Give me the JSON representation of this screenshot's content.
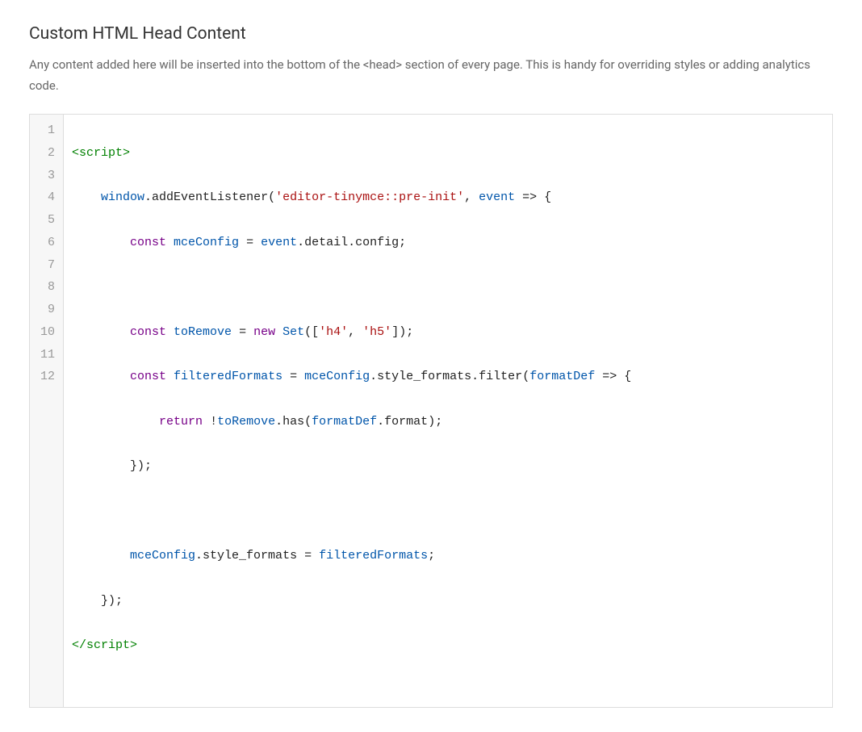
{
  "heading": "Custom HTML Head Content",
  "description": "Any content added here will be inserted into the bottom of the <head> section of every page. This is handy for overriding styles or adding analytics code.",
  "line_numbers": [
    "1",
    "2",
    "3",
    "4",
    "5",
    "6",
    "7",
    "8",
    "9",
    "10",
    "11",
    "12"
  ],
  "code": {
    "l1": {
      "open_tag_lt": "<",
      "open_tag_name": "script",
      "open_tag_gt": ">"
    },
    "l2": {
      "indent": "    ",
      "obj": "window",
      "dot1": ".",
      "method": "addEventListener",
      "paren_open": "(",
      "str": "'editor-tinymce::pre-init'",
      "comma": ", ",
      "param": "event",
      "arrow": " => {"
    },
    "l3": {
      "indent": "        ",
      "kw": "const",
      "sp": " ",
      "name": "mceConfig",
      "eq": " = ",
      "src": "event",
      "dot1": ".",
      "p1": "detail",
      "dot2": ".",
      "p2": "config",
      "semi": ";"
    },
    "l4": {
      "blank": ""
    },
    "l5": {
      "indent": "        ",
      "kw": "const",
      "sp": " ",
      "name": "toRemove",
      "eq": " = ",
      "new": "new",
      "sp2": " ",
      "cls": "Set",
      "paren_open": "([",
      "s1": "'h4'",
      "comma": ", ",
      "s2": "'h5'",
      "paren_close": "]);"
    },
    "l6": {
      "indent": "        ",
      "kw": "const",
      "sp": " ",
      "name": "filteredFormats",
      "eq": " = ",
      "obj": "mceConfig",
      "dot1": ".",
      "p1": "style_formats",
      "dot2": ".",
      "method": "filter",
      "paren_open": "(",
      "param": "formatDef",
      "arrow": " => {"
    },
    "l7": {
      "indent": "            ",
      "kw": "return",
      "sp": " ",
      "not": "!",
      "obj": "toRemove",
      "dot1": ".",
      "method": "has",
      "paren_open": "(",
      "arg": "formatDef",
      "dot2": ".",
      "p1": "format",
      "paren_close": ");"
    },
    "l8": {
      "indent": "        ",
      "close": "});"
    },
    "l9": {
      "blank": ""
    },
    "l10": {
      "indent": "        ",
      "obj": "mceConfig",
      "dot1": ".",
      "p1": "style_formats",
      "eq": " = ",
      "rhs": "filteredFormats",
      "semi": ";"
    },
    "l11": {
      "indent": "    ",
      "close": "});"
    },
    "l12": {
      "close_tag_lt": "</",
      "close_tag_name": "script",
      "close_tag_gt": ">"
    }
  }
}
